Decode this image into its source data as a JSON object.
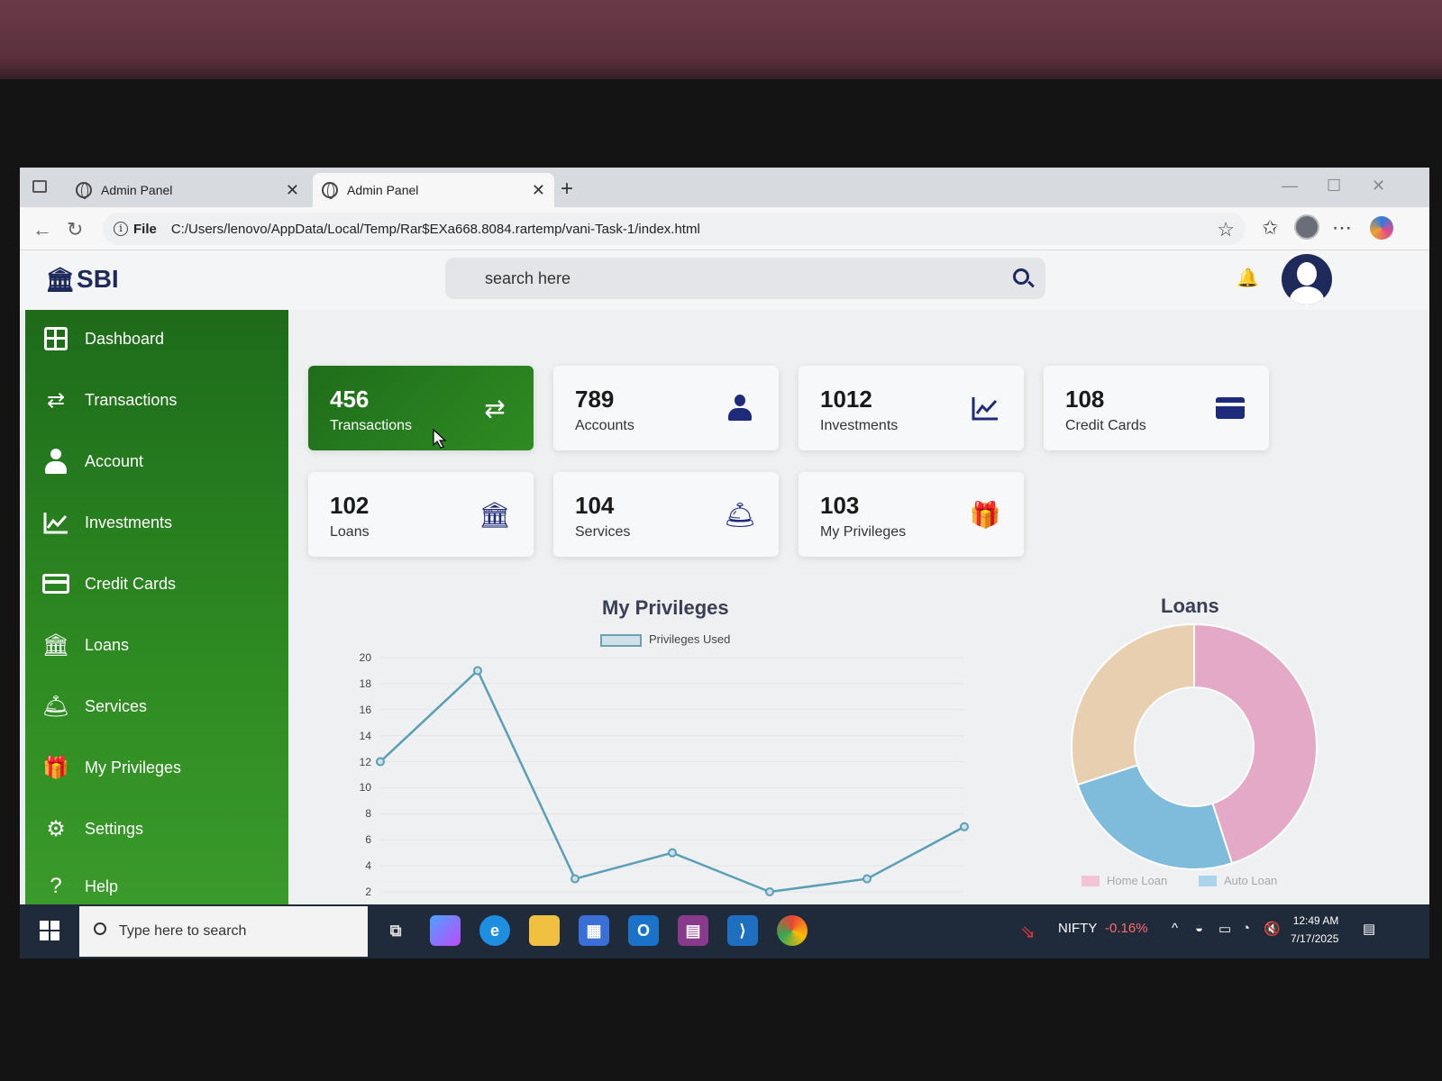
{
  "browser": {
    "tabs": [
      {
        "label": "Admin Panel",
        "active": false
      },
      {
        "label": "Admin Panel",
        "active": true
      }
    ],
    "address": {
      "scheme_label": "File",
      "url": "C:/Users/lenovo/AppData/Local/Temp/Rar$EXa668.8084.rartemp/vani-Task-1/index.html"
    }
  },
  "header": {
    "logo": "SBI",
    "search_placeholder": "search here"
  },
  "sidebar": {
    "items": [
      {
        "label": "Dashboard",
        "icon": "dashboard-icon"
      },
      {
        "label": "Transactions",
        "icon": "exchange-icon"
      },
      {
        "label": "Account",
        "icon": "user-icon"
      },
      {
        "label": "Investments",
        "icon": "line-chart-icon"
      },
      {
        "label": "Credit Cards",
        "icon": "credit-card-icon"
      },
      {
        "label": "Loans",
        "icon": "bank-icon"
      },
      {
        "label": "Services",
        "icon": "service-bell-icon"
      },
      {
        "label": "My Privileges",
        "icon": "gift-icon"
      },
      {
        "label": "Settings",
        "icon": "gear-icon"
      },
      {
        "label": "Help",
        "icon": "question-icon"
      }
    ]
  },
  "stats": [
    {
      "value": "456",
      "label": "Transactions",
      "icon": "exchange-icon",
      "highlight": true
    },
    {
      "value": "789",
      "label": "Accounts",
      "icon": "user-icon"
    },
    {
      "value": "1012",
      "label": "Investments",
      "icon": "line-chart-icon"
    },
    {
      "value": "108",
      "label": "Credit Cards",
      "icon": "credit-card-icon"
    },
    {
      "value": "102",
      "label": "Loans",
      "icon": "bank-icon"
    },
    {
      "value": "104",
      "label": "Services",
      "icon": "service-bell-icon"
    },
    {
      "value": "103",
      "label": "My Privileges",
      "icon": "gift-icon"
    }
  ],
  "chart_data": [
    {
      "type": "line",
      "title": "My Privileges",
      "series": [
        {
          "name": "Privileges Used",
          "values": [
            12,
            19,
            3,
            5,
            2,
            3,
            7
          ]
        }
      ],
      "ylim": [
        2,
        20
      ],
      "yticks": [
        20,
        18,
        16,
        14,
        12,
        10,
        8,
        6,
        4,
        2
      ],
      "grid": true,
      "legend": "top",
      "color": "#5b9fb5"
    },
    {
      "type": "pie",
      "title": "Loans",
      "donut": true,
      "slices": [
        {
          "name": "Home Loan",
          "value": 45,
          "color": "#e3a9c6"
        },
        {
          "name": "Auto Loan",
          "value": 25,
          "color": "#7fbcdc"
        },
        {
          "name": "",
          "value": 30,
          "color": "#e8cfb0"
        }
      ],
      "legend": "bottom"
    }
  ],
  "taskbar": {
    "search_placeholder": "Type here to search",
    "ticker_name": "NIFTY",
    "ticker_change": "-0.16%",
    "time": "12:49 AM",
    "date": "7/17/2025"
  },
  "colors": {
    "sidebar_green": "#2e8b22",
    "accent_navy": "#1e2a7a",
    "ticker_red": "#ff6b6b"
  }
}
